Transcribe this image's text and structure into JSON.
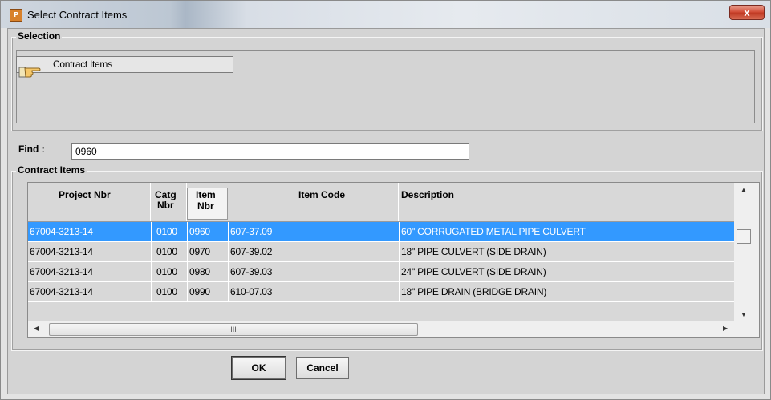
{
  "window": {
    "title": "Select Contract Items",
    "icon": "prism-app-icon",
    "close_label": "x"
  },
  "selection": {
    "group_label": "Selection",
    "button_label": "Contract Items",
    "button_icon": "pointing-hand-icon"
  },
  "find": {
    "label": "Find :",
    "value": "0960"
  },
  "contract_items": {
    "group_label": "Contract Items",
    "headers": {
      "project_nbr": "Project Nbr",
      "catg_nbr_1": "Catg",
      "catg_nbr_2": "Nbr",
      "item_nbr_1": "Item",
      "item_nbr_2": "Nbr",
      "item_code": "Item Code",
      "description": "Description"
    },
    "rows": [
      {
        "project": "67004-3213-14",
        "catg": "0100",
        "item": "0960",
        "code": "607-37.09",
        "desc": "60\" CORRUGATED METAL PIPE CULVERT",
        "selected": true
      },
      {
        "project": "67004-3213-14",
        "catg": "0100",
        "item": "0970",
        "code": "607-39.02",
        "desc": "18\" PIPE CULVERT (SIDE DRAIN)",
        "selected": false
      },
      {
        "project": "67004-3213-14",
        "catg": "0100",
        "item": "0980",
        "code": "607-39.03",
        "desc": "24\" PIPE CULVERT (SIDE DRAIN)",
        "selected": false
      },
      {
        "project": "67004-3213-14",
        "catg": "0100",
        "item": "0990",
        "code": "610-07.03",
        "desc": "18\" PIPE DRAIN (BRIDGE DRAIN)",
        "selected": false
      }
    ],
    "hscroll_grip": "III"
  },
  "buttons": {
    "ok": "OK",
    "cancel": "Cancel"
  },
  "colors": {
    "selected_row": "#3399ff",
    "close_button": "#c8452e",
    "background": "#d4d4d4"
  }
}
